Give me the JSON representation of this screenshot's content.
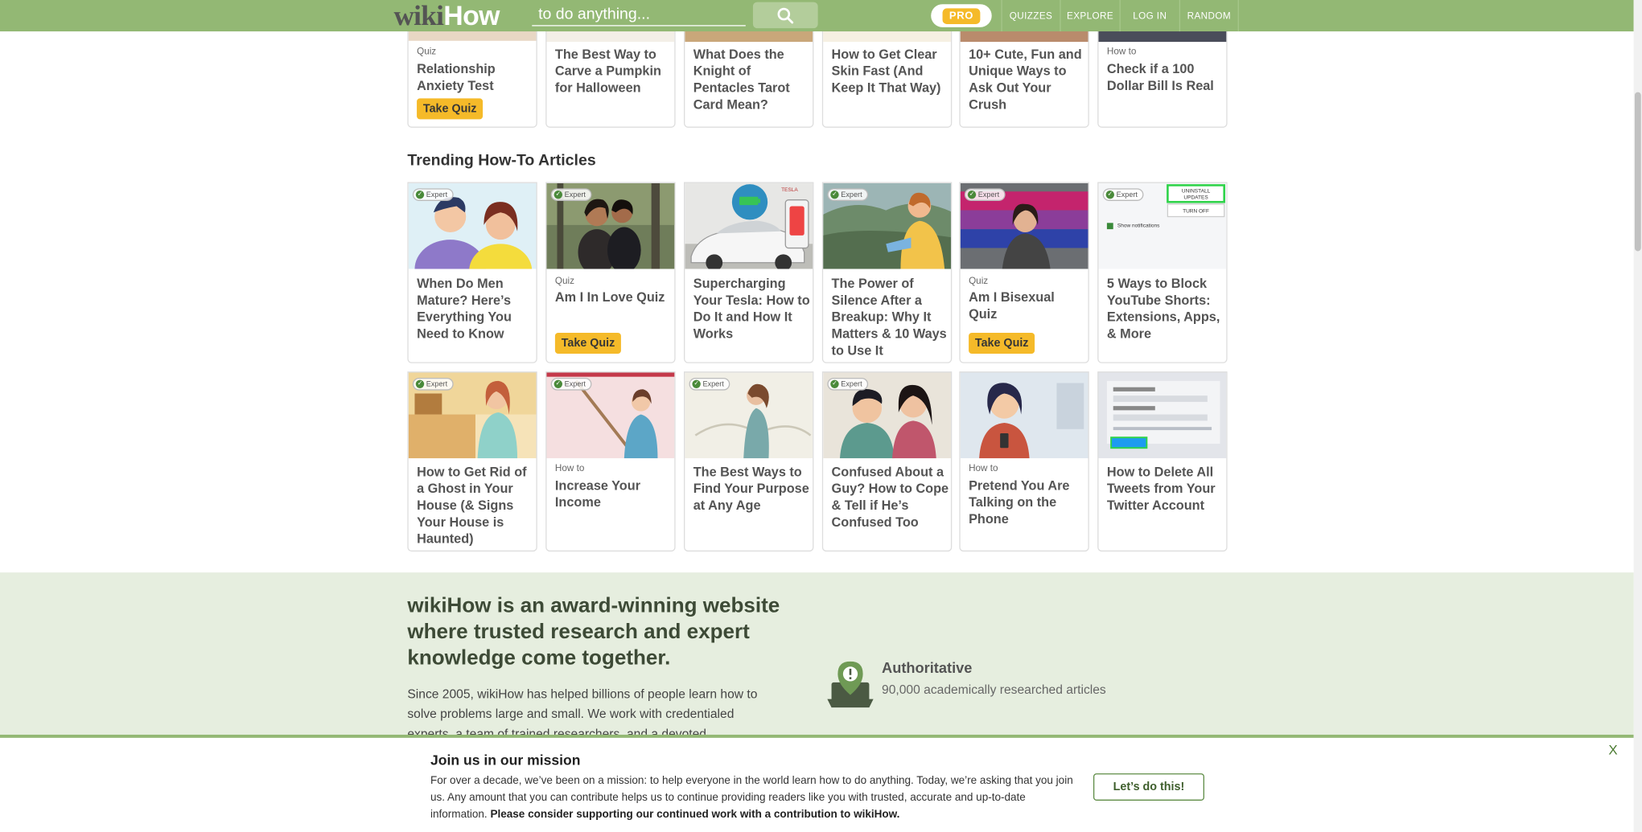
{
  "header": {
    "logo_wiki": "wiki",
    "logo_how": "How",
    "search_placeholder": "to do anything...",
    "pro_label": "PRO",
    "nav": [
      "QUIZZES",
      "EXPLORE",
      "LOG IN",
      "RANDOM"
    ]
  },
  "top_row": [
    {
      "kicker": "Quiz",
      "title": "Relationship Anxiety Test",
      "button": "Take Quiz"
    },
    {
      "kicker": "",
      "title": "The Best Way to Carve a Pumpkin for Halloween"
    },
    {
      "kicker": "",
      "title": "What Does the Knight of Pentacles Tarot Card Mean?"
    },
    {
      "kicker": "",
      "title": "How to Get Clear Skin Fast (And Keep It That Way)"
    },
    {
      "kicker": "",
      "title": "10+ Cute, Fun and Unique Ways to Ask Out Your Crush"
    },
    {
      "kicker": "How to",
      "title": "Check if a 100 Dollar Bill Is Real"
    }
  ],
  "trending": {
    "title": "Trending How-To Articles",
    "expert_label": "Expert",
    "row1": [
      {
        "kicker": "",
        "title": "When Do Men Mature? Here’s Everything You Need to Know",
        "expert": true
      },
      {
        "kicker": "Quiz",
        "title": "Am I In Love Quiz",
        "button": "Take Quiz",
        "expert": true
      },
      {
        "kicker": "",
        "title": "Supercharging Your Tesla: How to Do It and How It Works",
        "expert": false
      },
      {
        "kicker": "",
        "title": "The Power of Silence After a Breakup: Why It Matters & 10 Ways to Use It",
        "expert": true
      },
      {
        "kicker": "Quiz",
        "title": "Am I Bisexual Quiz",
        "button": "Take Quiz",
        "expert": true
      },
      {
        "kicker": "",
        "title": "5 Ways to Block YouTube Shorts: Extensions, Apps, & More",
        "expert": true
      }
    ],
    "row2": [
      {
        "kicker": "",
        "title": "How to Get Rid of a Ghost in Your House (& Signs Your House is Haunted)",
        "expert": true
      },
      {
        "kicker": "How to",
        "title": "Increase Your Income",
        "expert": true
      },
      {
        "kicker": "",
        "title": "The Best Ways to Find Your Purpose at Any Age",
        "expert": true
      },
      {
        "kicker": "",
        "title": "Confused About a Guy? How to Cope & Tell if He’s Confused Too",
        "expert": true
      },
      {
        "kicker": "How to",
        "title": "Pretend You Are Talking on the Phone",
        "expert": false
      },
      {
        "kicker": "",
        "title": "How to Delete All Tweets from Your Twitter Account",
        "expert": false
      }
    ]
  },
  "about": {
    "headline": "wikiHow is an award-winning website where trusted research and expert knowledge come together.",
    "body": "Since 2005, wikiHow has helped billions of people learn how to solve problems large and small. We work with credentialed experts, a team of trained researchers, and a devoted",
    "feature_title": "Authoritative",
    "feature_sub": "90,000 academically researched articles"
  },
  "banner": {
    "title": "Join us in our mission",
    "body": "For over a decade, we’ve been on a mission: to help everyone in the world learn how to do anything. Today, we’re asking that you join us. Any amount that you can contribute helps us to continue providing readers like you with trusted, accurate and up-to-date information.",
    "body_bold": "Please consider supporting our continued work with a contribution to wikiHow.",
    "cta": "Let’s do this!",
    "close": "X"
  },
  "thumbnail_labels": {
    "tesla_badge": "TESLA",
    "uninstall": "UNINSTALL UPDATES",
    "turn_off": "TURN OFF",
    "show_notifications": "Show notifications"
  },
  "colors": {
    "header_green": "#93b874",
    "quiz_yellow": "#f5ba29",
    "about_bg": "#e6eedf"
  }
}
